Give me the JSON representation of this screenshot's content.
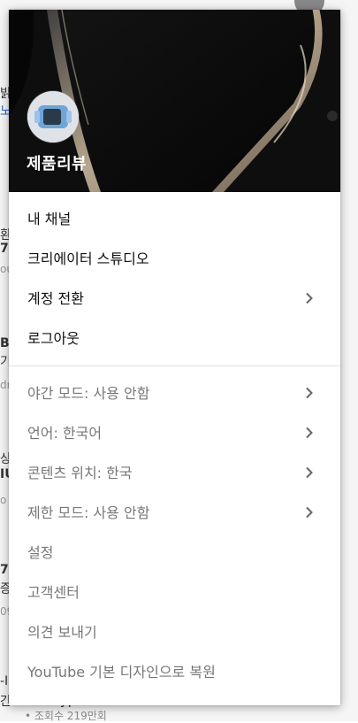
{
  "menu": {
    "channel_name": "제품리뷰",
    "account_items": [
      {
        "label": "내 채널",
        "has_arrow": false
      },
      {
        "label": "크리에이터 스튜디오",
        "has_arrow": false
      },
      {
        "label": "계정 전환",
        "has_arrow": true
      },
      {
        "label": "로그아웃",
        "has_arrow": false
      }
    ],
    "settings_items": [
      {
        "label": "야간 모드: 사용 안함",
        "has_arrow": true
      },
      {
        "label": "언어: 한국어",
        "has_arrow": true
      },
      {
        "label": "콘텐츠 위치: 한국",
        "has_arrow": true
      },
      {
        "label": "제한 모드: 사용 안함",
        "has_arrow": true
      },
      {
        "label": "설정",
        "has_arrow": false
      },
      {
        "label": "고객센터",
        "has_arrow": false
      },
      {
        "label": "의견 보내기",
        "has_arrow": false
      },
      {
        "label": "YouTube 기본 디자인으로 복원",
        "has_arrow": false
      }
    ]
  },
  "background": {
    "bottom_title": "- Peyphone Watch",
    "bottom_meta": "• 조회수 219만회"
  },
  "colors": {
    "menu_bg": "#ffffff",
    "primary_text": "#111111",
    "muted_text": "#777777",
    "divider": "#e0e0e0"
  }
}
